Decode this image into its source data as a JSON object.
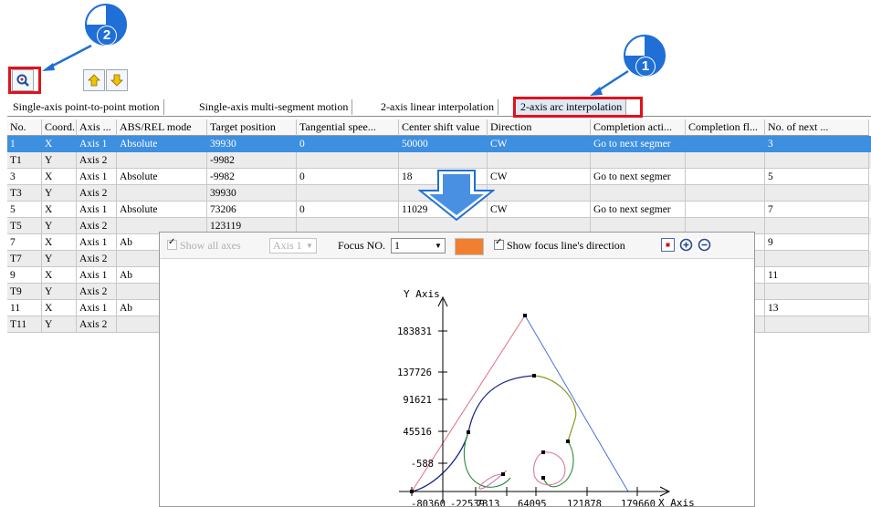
{
  "callouts": {
    "step1": "1",
    "step2": "2"
  },
  "toolbar": {
    "icons": [
      "magnifier-plot-icon",
      "arrow-up-icon",
      "arrow-down-icon"
    ]
  },
  "tabs": [
    "Single-axis point-to-point motion",
    "Single-axis multi-segment motion",
    "2-axis linear interpolation",
    "2-axis arc interpolation"
  ],
  "active_tab": 3,
  "table": {
    "columns": [
      "No.",
      "Coord.",
      "Axis ...",
      "ABS/REL mode",
      "Target position",
      "Tangential spee...",
      "Center shift value",
      "Direction",
      "Completion acti...",
      "Completion fl...",
      "No. of next ..."
    ],
    "rows": [
      [
        "1",
        "X",
        "Axis 1",
        "Absolute",
        "39930",
        "0",
        "50000",
        "CW",
        "Go to next segmer",
        "",
        "3"
      ],
      [
        "T1",
        "Y",
        "Axis 2",
        "",
        "-9982",
        "",
        "",
        "",
        "",
        "",
        ""
      ],
      [
        "3",
        "X",
        "Axis 1",
        "Absolute",
        "-9982",
        "0",
        "18",
        "CW",
        "Go to next segmer",
        "",
        "5"
      ],
      [
        "T3",
        "Y",
        "Axis 2",
        "",
        "39930",
        "",
        "",
        "",
        "",
        "",
        ""
      ],
      [
        "5",
        "X",
        "Axis 1",
        "Absolute",
        "73206",
        "0",
        "11029",
        "CW",
        "Go to next segmer",
        "",
        "7"
      ],
      [
        "T5",
        "Y",
        "Axis 2",
        "",
        "123119",
        "",
        "",
        "",
        "",
        "",
        ""
      ],
      [
        "7",
        "X",
        "Axis 1",
        "Ab",
        "",
        "",
        "",
        "",
        "",
        "",
        "9"
      ],
      [
        "T7",
        "Y",
        "Axis 2",
        "",
        "",
        "",
        "",
        "",
        "",
        "",
        ""
      ],
      [
        "9",
        "X",
        "Axis 1",
        "Ab",
        "",
        "",
        "",
        "",
        "",
        "",
        "11"
      ],
      [
        "T9",
        "Y",
        "Axis 2",
        "",
        "",
        "",
        "",
        "",
        "",
        "",
        ""
      ],
      [
        "11",
        "X",
        "Axis 1",
        "Ab",
        "",
        "",
        "",
        "",
        "",
        "",
        "13"
      ],
      [
        "T11",
        "Y",
        "Axis 2",
        "",
        "",
        "",
        "",
        "",
        "",
        "",
        ""
      ]
    ],
    "selected_row": 0
  },
  "plot": {
    "show_all_axes_label": "Show all axes",
    "axis_combo": "Axis 1",
    "focus_label": "Focus NO.",
    "focus_value": "1",
    "focus_color": "#f08030",
    "show_focus_direction_label": "Show focus line's direction",
    "y_axis_label": "Y Axis",
    "x_axis_label": "X Axis",
    "y_ticks": [
      "183831",
      "137726",
      "91621",
      "45516",
      "-588"
    ],
    "x_ticks": [
      "-80360",
      "-22539",
      "7313",
      "64095",
      "121878",
      "179660"
    ]
  },
  "colors": {
    "selected_row": "#3d8fe0",
    "callout_blue": "#1f6fd6",
    "highlight_red": "#e0121b"
  }
}
